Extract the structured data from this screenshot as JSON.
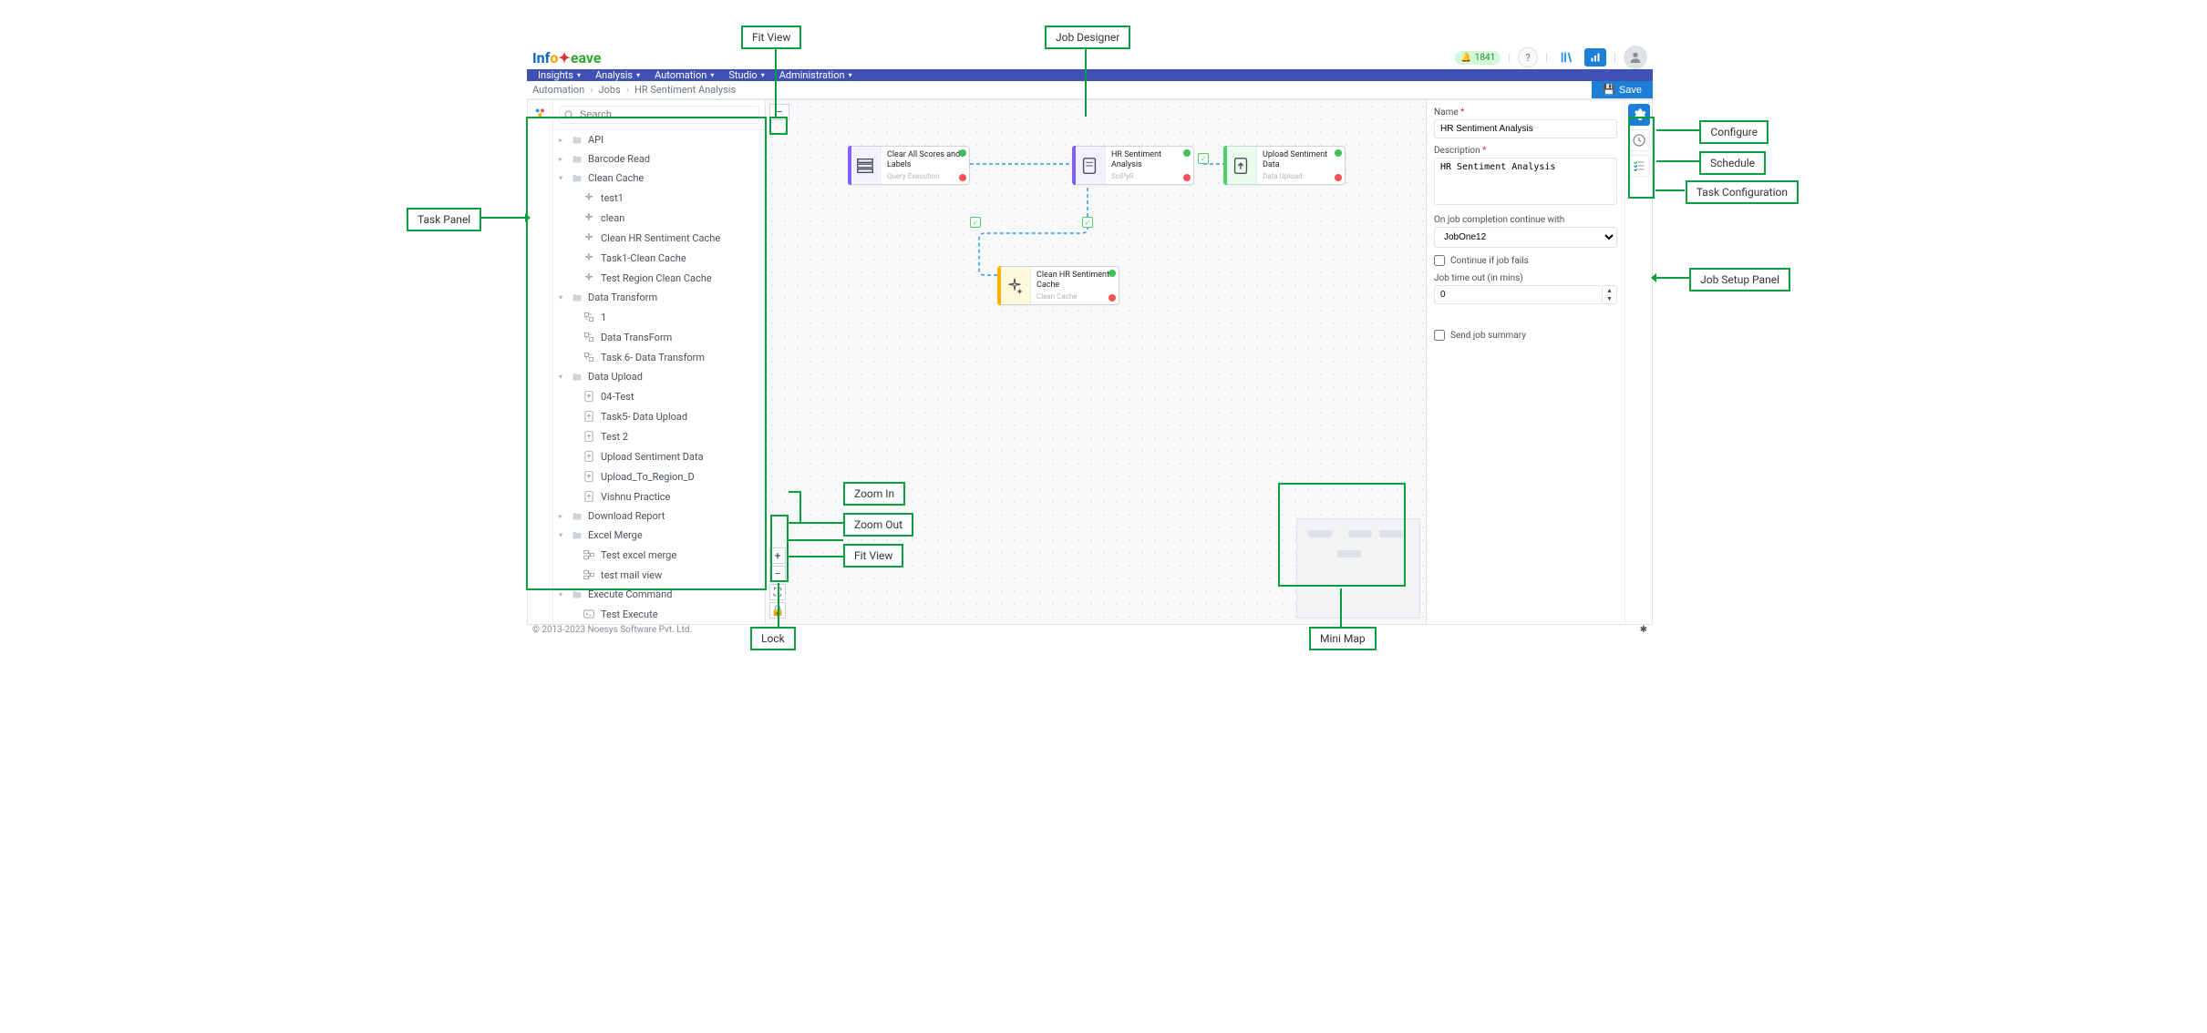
{
  "callouts": {
    "fit_view_top": "Fit View",
    "job_designer": "Job Designer",
    "task_panel": "Task Panel",
    "configure": "Configure",
    "schedule": "Schedule",
    "task_configuration": "Task Configuration",
    "job_setup_panel": "Job Setup Panel",
    "zoom_in": "Zoom In",
    "zoom_out": "Zoom Out",
    "fit_view": "Fit View",
    "lock": "Lock",
    "mini_map": "Mini Map"
  },
  "header": {
    "logo_info": "Inf",
    "logo_o": "o",
    "logo_weave": "eave",
    "notif_count": "1841"
  },
  "nav": {
    "items": [
      "Insights",
      "Analysis",
      "Automation",
      "Studio",
      "Administration"
    ]
  },
  "breadcrumb": [
    "Automation",
    "Jobs",
    "HR Sentiment Analysis"
  ],
  "save_label": "Save",
  "search_placeholder": "Search",
  "tree": [
    {
      "type": "folder",
      "label": "API",
      "open": false
    },
    {
      "type": "folder",
      "label": "Barcode Read",
      "open": false
    },
    {
      "type": "folder",
      "label": "Clean Cache",
      "open": true,
      "children": [
        {
          "label": "test1",
          "icon": "sparkle"
        },
        {
          "label": "clean",
          "icon": "sparkle"
        },
        {
          "label": "Clean HR Sentiment Cache",
          "icon": "sparkle"
        },
        {
          "label": "Task1-Clean Cache",
          "icon": "sparkle"
        },
        {
          "label": "Test Region Clean Cache",
          "icon": "sparkle"
        }
      ]
    },
    {
      "type": "folder",
      "label": "Data Transform",
      "open": true,
      "children": [
        {
          "label": "1",
          "icon": "transform"
        },
        {
          "label": "Data TransForm",
          "icon": "transform"
        },
        {
          "label": "Task 6- Data Transform",
          "icon": "transform"
        }
      ]
    },
    {
      "type": "folder",
      "label": "Data Upload",
      "open": true,
      "children": [
        {
          "label": "04-Test",
          "icon": "upload"
        },
        {
          "label": "Task5- Data Upload",
          "icon": "upload"
        },
        {
          "label": "Test 2",
          "icon": "upload"
        },
        {
          "label": "Upload Sentiment Data",
          "icon": "upload"
        },
        {
          "label": "Upload_To_Region_D",
          "icon": "upload"
        },
        {
          "label": "Vishnu Practice",
          "icon": "upload"
        }
      ]
    },
    {
      "type": "folder",
      "label": "Download Report",
      "open": false
    },
    {
      "type": "folder",
      "label": "Excel Merge",
      "open": true,
      "children": [
        {
          "label": "Test excel merge",
          "icon": "merge"
        },
        {
          "label": "test mail view",
          "icon": "merge"
        }
      ]
    },
    {
      "type": "folder",
      "label": "Execute Command",
      "open": true,
      "children": [
        {
          "label": "Test Execute",
          "icon": "cmd"
        }
      ]
    }
  ],
  "nodes": {
    "n1": {
      "title": "Clear All Scores and Labels",
      "subtitle": "Query Execution"
    },
    "n2": {
      "title": "HR Sentiment Analysis",
      "subtitle": "SciPyR"
    },
    "n3": {
      "title": "Upload Sentiment Data",
      "subtitle": "Data Upload"
    },
    "n4": {
      "title": "Clean HR Sentiment Cache",
      "subtitle": "Clean Cache"
    }
  },
  "setup": {
    "name_label": "Name",
    "name_value": "HR Sentiment Analysis",
    "desc_label": "Description",
    "desc_value": "HR Sentiment Analysis",
    "continue_label": "On job completion continue with",
    "continue_value": "JobOne12",
    "continue_if_fails": "Continue if job fails",
    "timeout_label": "Job time out (in mins)",
    "timeout_value": "0",
    "send_summary": "Send job summary"
  },
  "footer": "© 2013-2023 Noesys Software Pvt. Ltd."
}
